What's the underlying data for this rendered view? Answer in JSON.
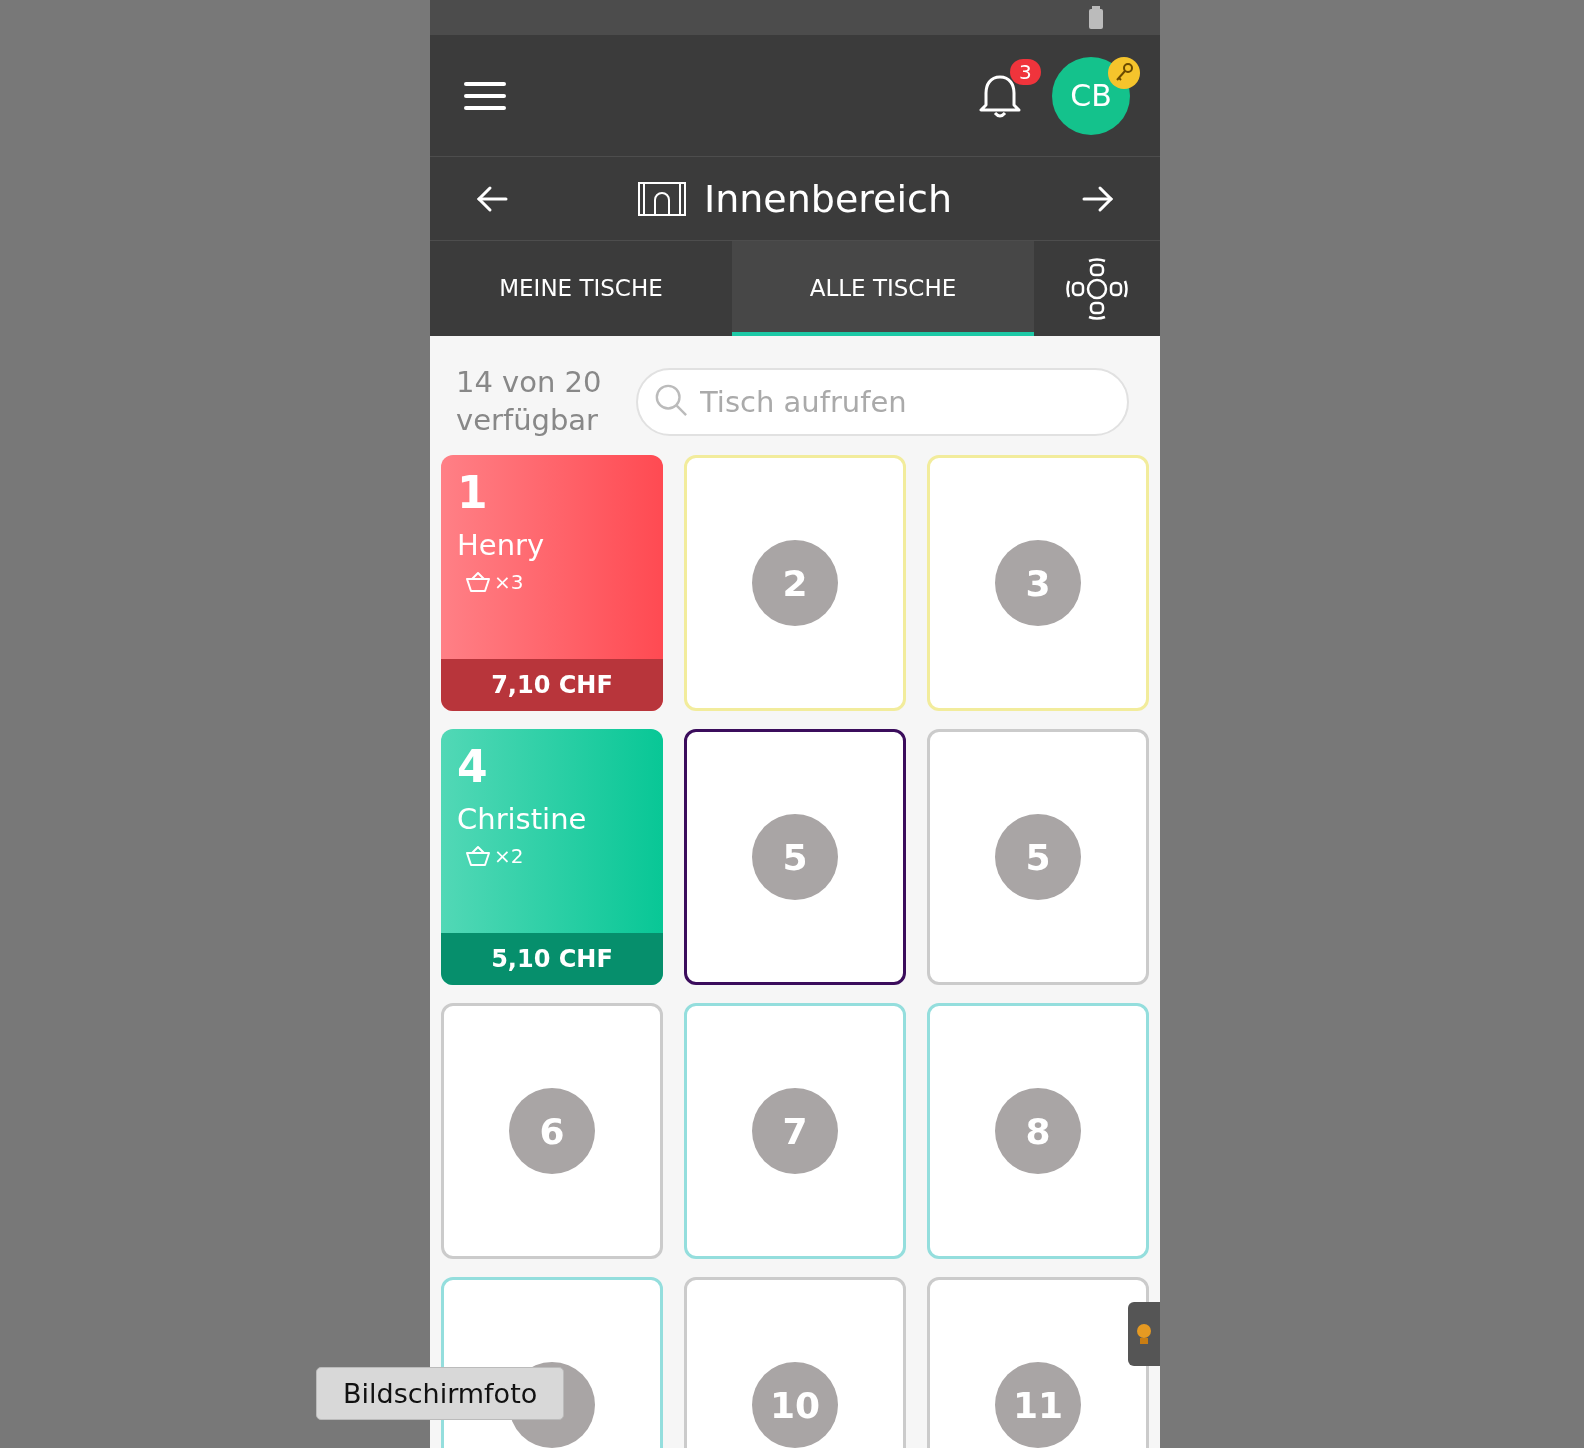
{
  "header": {
    "notification_count": "3",
    "avatar_initials": "CB"
  },
  "area": {
    "title": "Innenbereich"
  },
  "tabs": [
    {
      "label": "MEINE TISCHE",
      "selected": false
    },
    {
      "label": "ALLE TISCHE",
      "selected": true
    }
  ],
  "availability": "14 von 20 verfügbar",
  "search": {
    "placeholder": "Tisch aufrufen"
  },
  "tables": [
    {
      "kind": "occupied",
      "number": "1",
      "guest": "Henry",
      "items": "×3",
      "total": "7,10 CHF",
      "color": "#ff4a52"
    },
    {
      "kind": "free",
      "number": "2",
      "color": "#f2ec9c"
    },
    {
      "kind": "free",
      "number": "3",
      "color": "#f2ec9c"
    },
    {
      "kind": "occupied",
      "number": "4",
      "guest": "Christine",
      "items": "×2",
      "total": "5,10 CHF",
      "color": "#08c796"
    },
    {
      "kind": "free",
      "number": "5",
      "color": "#3b0d5c"
    },
    {
      "kind": "free",
      "number": "5",
      "color": "#cbcbcb"
    },
    {
      "kind": "free",
      "number": "6",
      "color": "#cbcbcb"
    },
    {
      "kind": "free",
      "number": "7",
      "color": "#94dedd"
    },
    {
      "kind": "free",
      "number": "8",
      "color": "#94dedd"
    },
    {
      "kind": "free",
      "color": "#94dedd"
    },
    {
      "kind": "free",
      "number": "10",
      "color": "#cbcbcb"
    },
    {
      "kind": "free",
      "number": "11",
      "color": "#cbcbcb"
    }
  ],
  "tooltip": "Bildschirmfoto"
}
